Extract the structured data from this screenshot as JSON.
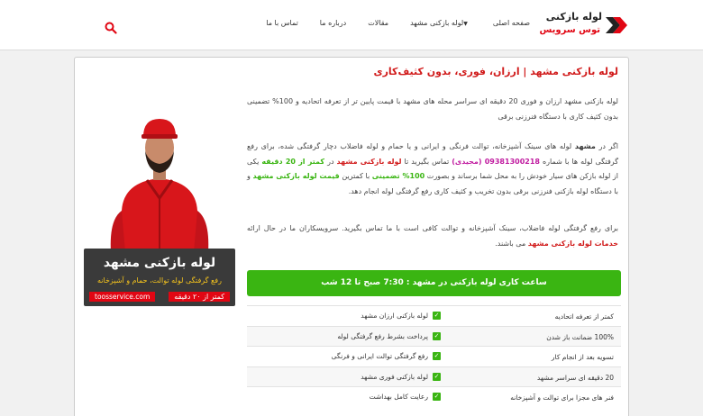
{
  "header": {
    "logo": {
      "line1": "لوله بازکنی",
      "line2": "توس سرویس"
    },
    "nav": [
      {
        "label": "صفحه اصلی",
        "dropdown": false
      },
      {
        "label": "لوله بازکنی مشهد",
        "dropdown": true
      },
      {
        "label": "مقالات",
        "dropdown": false
      },
      {
        "label": "درباره ما",
        "dropdown": false
      },
      {
        "label": "تماس با ما",
        "dropdown": false
      }
    ],
    "search_icon": "search-icon"
  },
  "article": {
    "title": "لوله بازکنی مشهد | ارزان، فوری، بدون کثیف‌کاری",
    "p1": "لوله بازکنی مشهد ارزان و فوری 20 دقیقه ای سراسر محله های مشهد با قیمت پایین تر از تعرفه اتحادیه و 100% تضمینی بدون کثیف کاری با دستگاه فنرزنی برقی",
    "p2": {
      "a": "اگر در ",
      "b": "مشهد",
      "c": " لوله های سینک آشپزخانه، توالت فرنگی و ایرانی و یا حمام و لوله فاضلاب دچار گرفتگی شده، برای رفع گرفتگی لوله ها با شماره ",
      "phone": "09381300218 (مجیدی)",
      "d": " تماس بگیرید تا ",
      "e": "لوله بازکنی مشهد",
      "f": " در ",
      "g": "کمتر از 20 دقیقه",
      "h": " یکی از لوله بازکن های سیار خودش را به محل شما برساند و بصورت ",
      "i": "100% تضمینی",
      "j": " با کمترین ",
      "k": "قیمت لوله بازکنی مشهد",
      "l": " و با دستگاه لوله بازکنی فنرزنی برقی بدون تخریب و کثیف کاری رفع گرفتگی لوله انجام دهد."
    },
    "p3": {
      "a": "برای رفع گرفتگی لوله فاضلاب، سینک آشپزخانه و توالت کافی است با ما تماس بگیرید. سرویسکاران ما در حال ارائه ",
      "b": "خدمات لوله بازکنی مشهد",
      "c": " می باشند."
    },
    "hours": "ساعت کاری لوله بازکنی در مشهد : 7:30 صبح تا 12 شب",
    "features": [
      {
        "right": "کمتر از تعرفه اتحادیه",
        "left": "لوله بازکنی ارزان مشهد"
      },
      {
        "right": "100% ضمانت باز شدن",
        "left": "پرداخت بشرط رفع گرفتگی لوله"
      },
      {
        "right": "تسویه بعد از انجام کار",
        "left": "رفع گرفتگی توالت ایرانی و فرنگی"
      },
      {
        "right": "20 دقیقه ای سراسر مشهد",
        "left": "لوله بازکنی فوری مشهد"
      },
      {
        "right": "فنر های مجزا برای توالت و آشپزخانه",
        "left": "رعایت کامل بهداشت"
      }
    ]
  },
  "promo": {
    "title": "لوله بازکنی مشهد",
    "subtitle": "رفع گرفتگی لوله توالت، حمام و آشپزخانه",
    "badge": "کمتر از ۲۰ دقیقه",
    "website": "toosservice.com"
  },
  "colors": {
    "accent_red": "#d11c1c",
    "accent_green": "#3ab512",
    "phone_purple": "#c01ca0"
  }
}
